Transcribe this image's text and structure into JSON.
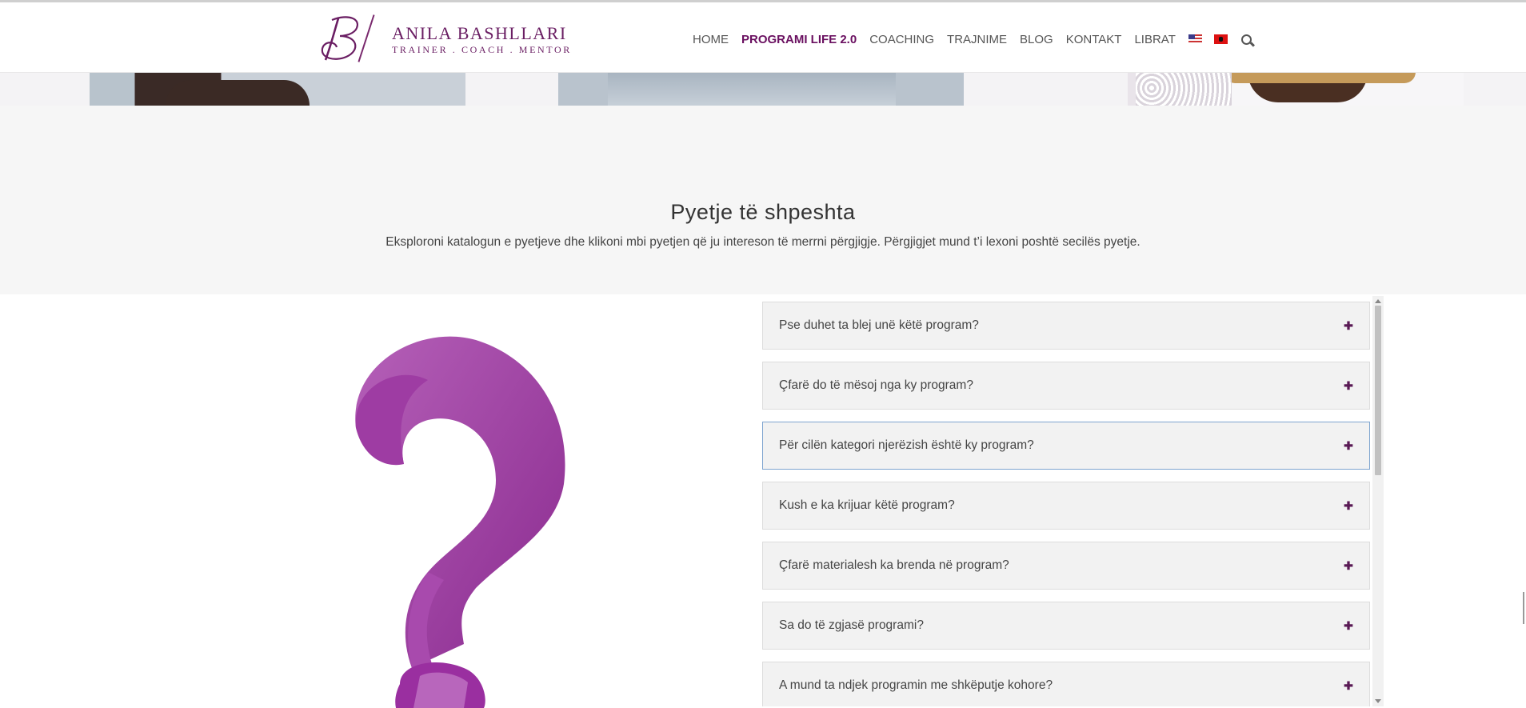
{
  "brand": {
    "name": "ANILA BASHLLARI",
    "tagline": "TRAINER . COACH . MENTOR",
    "color": "#6a1e63"
  },
  "nav": {
    "items": [
      {
        "label": "HOME",
        "active": false
      },
      {
        "label": "PROGRAMI LIFE 2.0",
        "active": true
      },
      {
        "label": "COACHING",
        "active": false
      },
      {
        "label": "TRAJNIME",
        "active": false
      },
      {
        "label": "BLOG",
        "active": false
      },
      {
        "label": "KONTAKT",
        "active": false
      },
      {
        "label": "LIBRAT",
        "active": false
      }
    ],
    "flags": [
      "us-flag-icon",
      "albania-flag-icon"
    ],
    "search_icon": "search-icon"
  },
  "faq": {
    "title": "Pyetje të shpeshta",
    "subtitle": "Eksploroni katalogun e pyetjeve dhe klikoni mbi pyetjen që ju intereson të merrni përgjigje. Përgjigjet mund t’i lexoni poshtë secilës pyetje.",
    "questions": [
      "Pse duhet ta blej unë këtë program?",
      "Çfarë do të mësoj nga ky program?",
      "Për cilën kategori njerëzish është ky program?",
      "Kush e ka krijuar këtë program?",
      "Çfarë materialesh ka brenda në program?",
      "Sa do të zgjasë programi?",
      "A mund ta ndjek programin me shkëputje kohore?"
    ],
    "focused_index": 2,
    "expand_icon": "plus-icon",
    "illustration": "question-mark-icon",
    "accent": "#9b2d9f"
  }
}
